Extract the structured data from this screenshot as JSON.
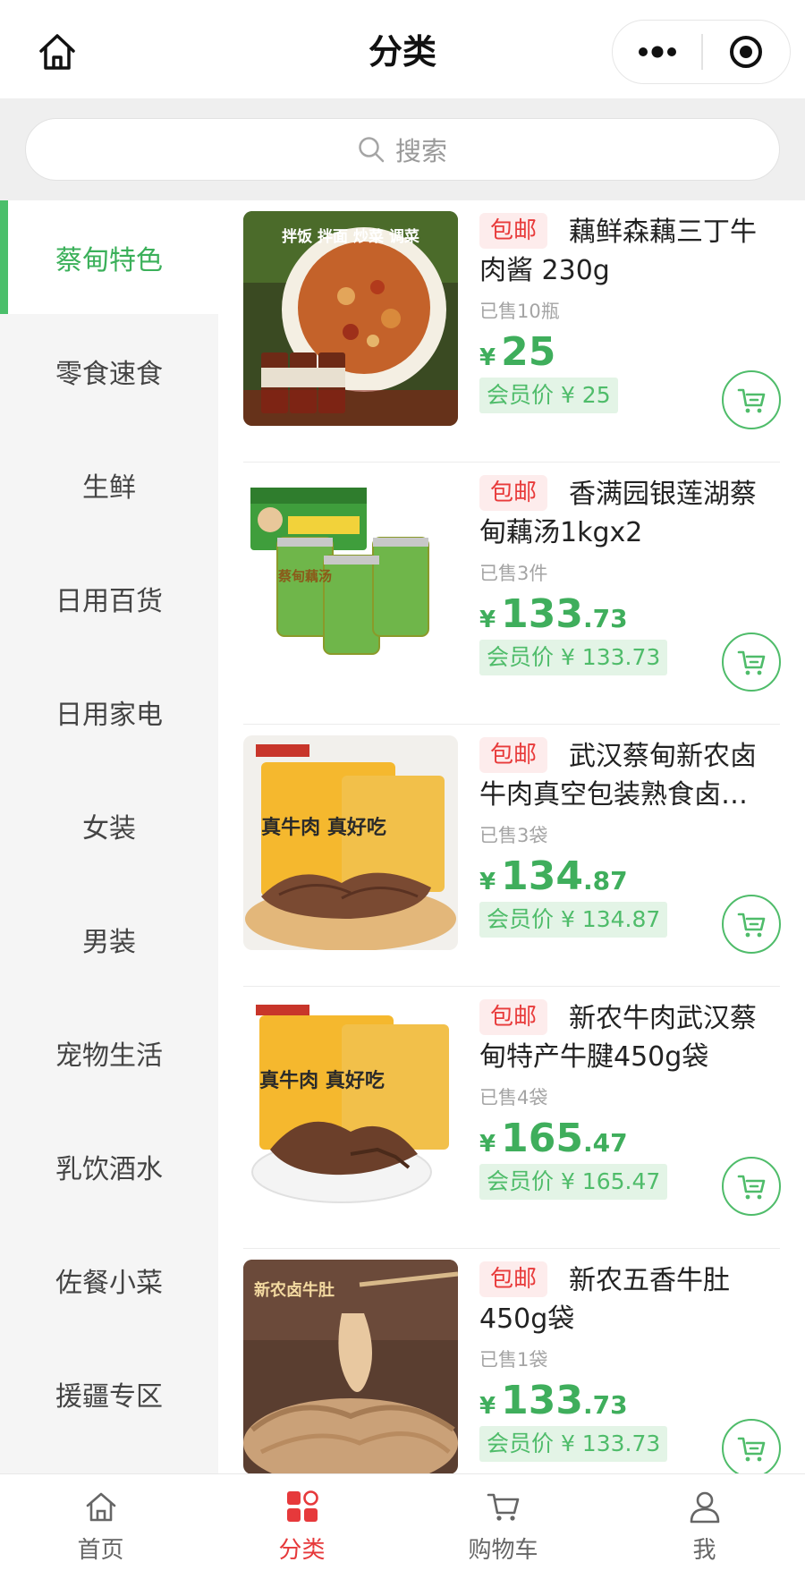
{
  "header": {
    "title": "分类"
  },
  "search": {
    "placeholder": "搜索"
  },
  "sidebar": {
    "items": [
      {
        "label": "蔡甸特色",
        "active": true
      },
      {
        "label": "零食速食"
      },
      {
        "label": "生鲜"
      },
      {
        "label": "日用百货"
      },
      {
        "label": "日用家电"
      },
      {
        "label": "女装"
      },
      {
        "label": "男装"
      },
      {
        "label": "宠物生活"
      },
      {
        "label": "乳饮酒水"
      },
      {
        "label": "佐餐小菜"
      },
      {
        "label": "援疆专区"
      }
    ]
  },
  "products": [
    {
      "tag": "包邮",
      "name": "藕鲜森藕三丁牛肉酱 230g",
      "sold": "已售10瓶",
      "price_yen": "¥",
      "price_int": "25",
      "price_dec": "",
      "member_price": "会员价 ¥ 25",
      "img_text": "拌饭 拌面 炒菜 调菜"
    },
    {
      "tag": "包邮",
      "name": "香满园银莲湖蔡甸藕汤1kgx2",
      "sold": "已售3件",
      "price_yen": "¥",
      "price_int": "133",
      "price_dec": ".73",
      "member_price": "会员价 ¥ 133.73",
      "img_text": "蔡甸藕汤"
    },
    {
      "tag": "包邮",
      "name": "武汉蔡甸新农卤牛肉真空包装熟食卤…",
      "sold": "已售3袋",
      "price_yen": "¥",
      "price_int": "134",
      "price_dec": ".87",
      "member_price": "会员价 ¥ 134.87",
      "img_text": "真牛肉 真好吃"
    },
    {
      "tag": "包邮",
      "name": "新农牛肉武汉蔡甸特产牛腱450g袋",
      "sold": "已售4袋",
      "price_yen": "¥",
      "price_int": "165",
      "price_dec": ".47",
      "member_price": "会员价 ¥ 165.47",
      "img_text": "真牛肉 真好吃"
    },
    {
      "tag": "包邮",
      "name": "新农五香牛肚450g袋",
      "sold": "已售1袋",
      "price_yen": "¥",
      "price_int": "133",
      "price_dec": ".73",
      "member_price": "会员价 ¥ 133.73",
      "img_text": "新农卤牛肚"
    }
  ],
  "tabbar": [
    {
      "label": "首页",
      "icon": "home-icon"
    },
    {
      "label": "分类",
      "icon": "category-icon",
      "active": true
    },
    {
      "label": "购物车",
      "icon": "cart-icon"
    },
    {
      "label": "我",
      "icon": "user-icon"
    }
  ],
  "colors": {
    "accent_green": "#4bbf6b",
    "tag_red": "#e83b3b",
    "tab_active_red": "#e6393b"
  }
}
